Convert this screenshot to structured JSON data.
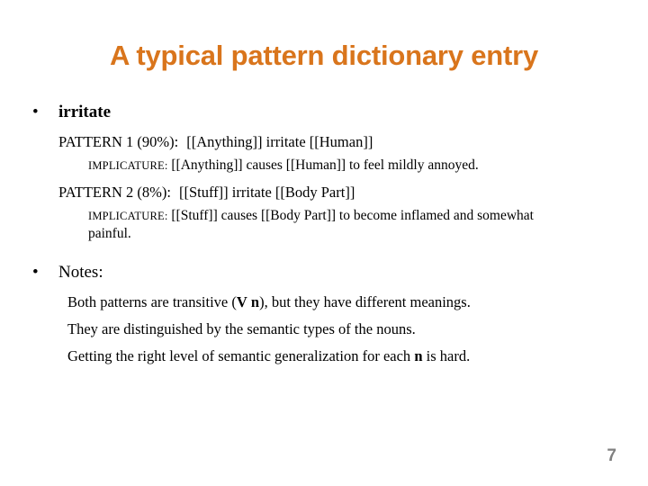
{
  "slide": {
    "title": "A typical pattern dictionary entry",
    "title_color": "#d9751c",
    "background_color": "#ffffff",
    "page_number": "7",
    "page_number_color": "#808080"
  },
  "entry": {
    "bullet_glyph": "•",
    "headword": "irritate",
    "patterns": [
      {
        "label": "PATTERN 1 (90%):",
        "body": "[[Anything]] irritate [[Human]]",
        "implicature_label": "IMPLICATURE:",
        "implicature_body": "[[Anything]] causes [[Human]] to feel mildly annoyed."
      },
      {
        "label": "PATTERN 2 (8%):",
        "body": "[[Stuff]] irritate [[Body Part]]",
        "implicature_label": "IMPLICATURE:",
        "implicature_body": "[[Stuff]] causes [[Body Part]] to become inflamed and somewhat painful."
      }
    ]
  },
  "notes": {
    "bullet_glyph": "•",
    "heading": "Notes:",
    "lines": [
      {
        "pre": "Both patterns are transitive (",
        "bold_1": "V",
        "mid": " ",
        "bold_2": "n",
        "post": "), but they have different meanings."
      },
      {
        "pre": "They are distinguished by the semantic types of the nouns.",
        "bold_1": "",
        "mid": "",
        "bold_2": "",
        "post": ""
      },
      {
        "pre": "Getting the right level of semantic generalization for each ",
        "bold_1": "",
        "mid": "",
        "bold_2": "n",
        "post": " is hard."
      }
    ]
  }
}
